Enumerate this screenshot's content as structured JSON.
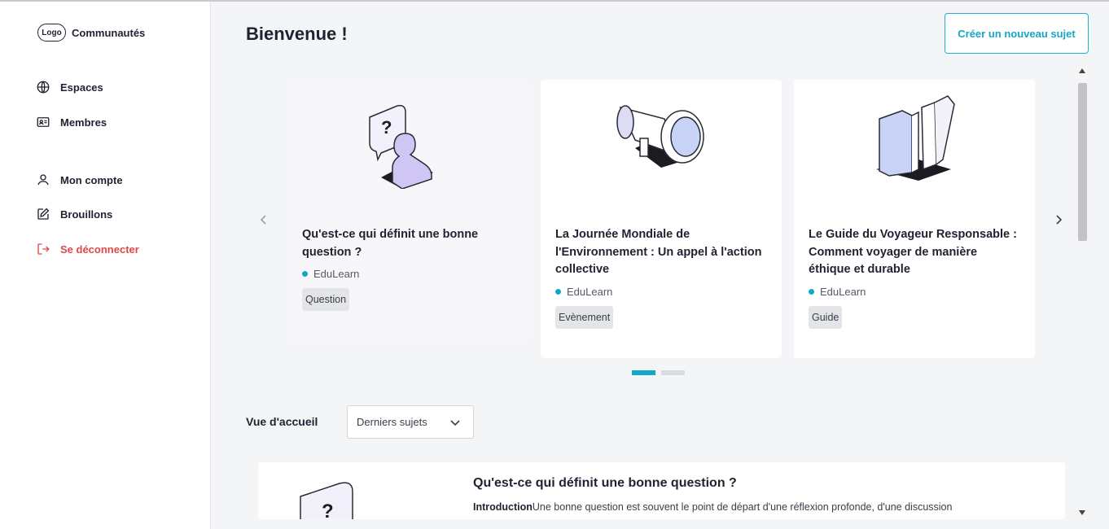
{
  "sidebar": {
    "logo_text": "Logo",
    "brand_name": "Communautés",
    "items": [
      {
        "label": "Espaces",
        "icon": "globe-icon"
      },
      {
        "label": "Membres",
        "icon": "id-card-icon"
      },
      {
        "label": "Mon compte",
        "icon": "user-icon"
      },
      {
        "label": "Brouillons",
        "icon": "edit-icon"
      },
      {
        "label": "Se déconnecter",
        "icon": "logout-icon",
        "color": "#e04848"
      }
    ]
  },
  "header": {
    "title": "Bienvenue !",
    "new_topic_label": "Créer un nouveau sujet"
  },
  "carousel": {
    "cards": [
      {
        "title": "Qu'est-ce qui définit une bonne question ?",
        "author": "EduLearn",
        "tag": "Question",
        "illustration": "question-bubble-person-illustration"
      },
      {
        "title": "La Journée Mondiale de l'Environnement : Un appel à l'action collective",
        "author": "EduLearn",
        "tag": "Evènement",
        "illustration": "megaphone-illustration"
      },
      {
        "title": "Le Guide du Voyageur Responsable : Comment voyager de manière éthique et durable",
        "author": "EduLearn",
        "tag": "Guide",
        "illustration": "books-illustration"
      }
    ],
    "active_page": 1,
    "page_count": 2
  },
  "home_view": {
    "label": "Vue d'accueil",
    "selected": "Derniers sujets"
  },
  "feed": {
    "items": [
      {
        "title": "Qu'est-ce qui définit une bonne question ?",
        "excerpt_label": "Introduction",
        "excerpt": "Une bonne question est souvent le point de départ d'une réflexion profonde, d'une discussion"
      }
    ]
  },
  "colors": {
    "accent": "#12a7c6",
    "danger": "#e04848",
    "background": "#f4f5f7"
  }
}
